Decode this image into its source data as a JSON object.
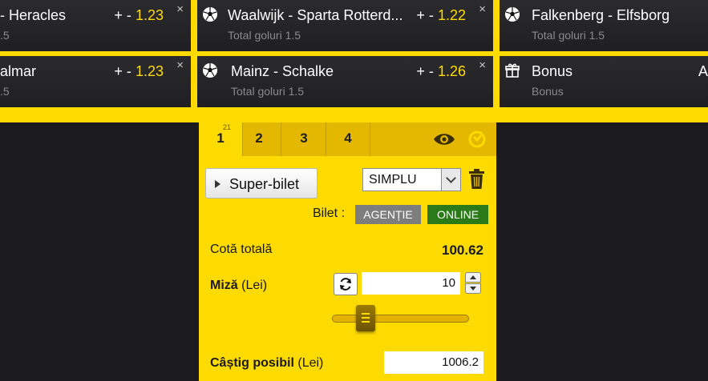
{
  "tickets": [
    {
      "title": "- Heracles",
      "sub": ".5",
      "pm": "+ -",
      "odds": "1.23",
      "close": "×"
    },
    {
      "title": "Waalwijk - Sparta Rotterd...",
      "sub": "Total goluri 1.5",
      "pm": "+ -",
      "odds": "1.22",
      "close": "×"
    },
    {
      "title": "Falkenberg - Elfsborg",
      "sub": "Total goluri 1.5",
      "pm": "",
      "odds": "",
      "close": "×"
    },
    {
      "title": "almar",
      "sub": ".5",
      "pm": "+ -",
      "odds": "1.23",
      "close": "×"
    },
    {
      "title": "Mainz - Schalke",
      "sub": "Total goluri 1.5",
      "pm": "+ -",
      "odds": "1.26",
      "close": "×"
    },
    {
      "title": "Bonus",
      "sub": "Bonus",
      "pm": "",
      "odds": "A",
      "close": ""
    }
  ],
  "tabs": [
    {
      "label": "1",
      "count": "21"
    },
    {
      "label": "2"
    },
    {
      "label": "3"
    },
    {
      "label": "4"
    }
  ],
  "betslip": {
    "super_bilet": "Super-bilet",
    "bet_type": "SIMPLU",
    "bilet_label": "Bilet :",
    "agentie": "AGENȚIE",
    "online": "ONLINE",
    "total_label": "Cotă totală",
    "total_value": "100.62",
    "miza_label": "Miză",
    "miza_unit": "(Lei)",
    "stake": "10",
    "castig_label": "Câștig posibil",
    "castig_unit": "(Lei)",
    "castig_value": "1006.2"
  },
  "colors": {
    "accent": "#fedb00",
    "online": "#2a7a1a",
    "agentie": "#7d7d7d",
    "card": "#232326"
  },
  "icons": {
    "ball": "soccer-ball-icon",
    "gift": "gift-icon",
    "eye": "eye-icon",
    "refresh": "refresh-icon",
    "trash": "trash-icon"
  }
}
